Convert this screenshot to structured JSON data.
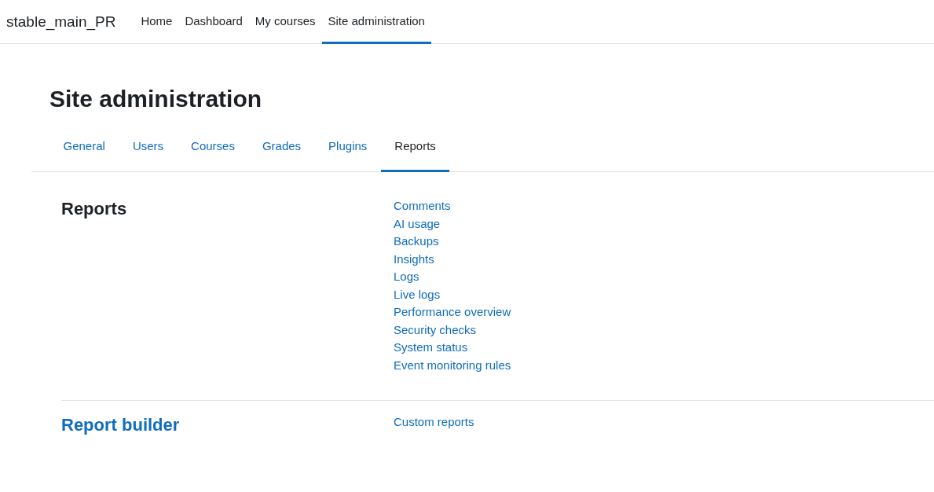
{
  "site_name": "stable_main_PR",
  "nav": [
    {
      "label": "Home",
      "selected": false
    },
    {
      "label": "Dashboard",
      "selected": false
    },
    {
      "label": "My courses",
      "selected": false
    },
    {
      "label": "Site administration",
      "selected": true
    }
  ],
  "page_title": "Site administration",
  "tabs": [
    {
      "label": "General",
      "selected": false
    },
    {
      "label": "Users",
      "selected": false
    },
    {
      "label": "Courses",
      "selected": false
    },
    {
      "label": "Grades",
      "selected": false
    },
    {
      "label": "Plugins",
      "selected": false
    },
    {
      "label": "Reports",
      "selected": true
    }
  ],
  "sections": [
    {
      "title": "Reports",
      "title_link": false,
      "links": [
        "Comments",
        "AI usage",
        "Backups",
        "Insights",
        "Logs",
        "Live logs",
        "Performance overview",
        "Security checks",
        "System status",
        "Event monitoring rules"
      ]
    },
    {
      "title": "Report builder",
      "title_link": true,
      "links": [
        "Custom reports"
      ]
    }
  ]
}
